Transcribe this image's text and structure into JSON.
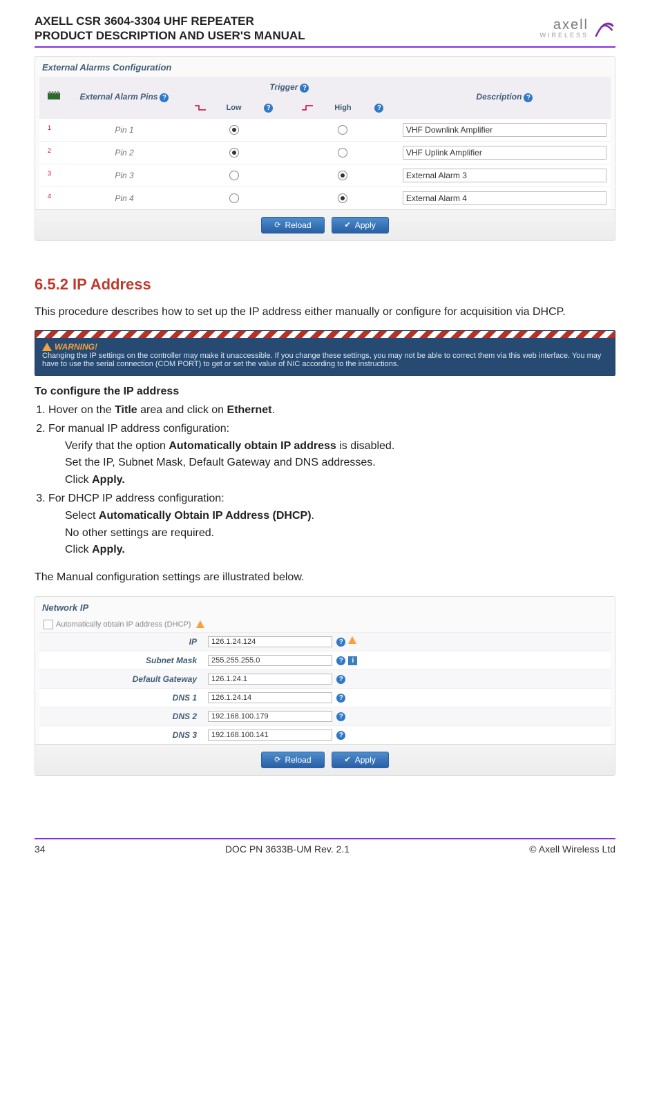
{
  "header": {
    "line1": "AXELL CSR 3604-3304 UHF REPEATER",
    "line2": "PRODUCT DESCRIPTION AND USER'S MANUAL",
    "logo_word": "axell",
    "logo_sub": "WIRELESS"
  },
  "alarms_panel": {
    "title": "External Alarms Configuration",
    "col_pins": "External Alarm Pins",
    "col_trigger": "Trigger",
    "col_low": "Low",
    "col_high": "High",
    "col_desc": "Description",
    "rows": [
      {
        "pin": "Pin 1",
        "sup": "1",
        "low": true,
        "high": false,
        "desc": "VHF Downlink Amplifier"
      },
      {
        "pin": "Pin 2",
        "sup": "2",
        "low": true,
        "high": false,
        "desc": "VHF Uplink Amplifier"
      },
      {
        "pin": "Pin 3",
        "sup": "3",
        "low": false,
        "high": true,
        "desc": "External Alarm 3"
      },
      {
        "pin": "Pin 4",
        "sup": "4",
        "low": false,
        "high": true,
        "desc": "External Alarm 4"
      }
    ],
    "reload": "Reload",
    "apply": "Apply"
  },
  "section": {
    "heading": "6.5.2 IP Address",
    "intro": "This procedure describes how to set up the IP address either manually or configure for acquisition via DHCP.",
    "warning_title": "WARNING!",
    "warning_body": "Changing the IP settings on the controller may make it unaccessible. If you change these settings, you may not be able to correct them via this web interface. You may have to use the serial connection (COM PORT) to get or set the value of NIC according to the instructions.",
    "subhead": "To configure the IP address",
    "step1_a": "Hover on the ",
    "step1_b": "Title",
    "step1_c": " area and click on ",
    "step1_d": "Ethernet",
    "step1_e": ".",
    "step2": "For manual IP address configuration:",
    "step2_a_pre": "Verify that the option ",
    "step2_a_bold": "Automatically obtain IP address",
    "step2_a_post": " is disabled.",
    "step2_b": "Set the IP, Subnet Mask, Default Gateway and DNS addresses.",
    "step2_c_pre": "Click ",
    "step2_c_bold": "Apply.",
    "step3": "For DHCP IP address configuration:",
    "step3_a_pre": "Select ",
    "step3_a_bold": "Automatically Obtain IP Address (DHCP)",
    "step3_a_post": ".",
    "step3_b": "No other settings are required.",
    "step3_c_pre": "Click ",
    "step3_c_bold": "Apply.",
    "closing": "The Manual configuration settings are illustrated below."
  },
  "ip_panel": {
    "title": "Network IP",
    "auto_label": "Automatically obtain IP address (DHCP)",
    "fields": [
      {
        "label": "IP",
        "value": "126.1.24.124",
        "warn": true,
        "info": false
      },
      {
        "label": "Subnet Mask",
        "value": "255.255.255.0",
        "warn": false,
        "info": true
      },
      {
        "label": "Default Gateway",
        "value": "126.1.24.1",
        "warn": false,
        "info": false
      },
      {
        "label": "DNS 1",
        "value": "126.1.24.14",
        "warn": false,
        "info": false
      },
      {
        "label": "DNS 2",
        "value": "192.168.100.179",
        "warn": false,
        "info": false
      },
      {
        "label": "DNS 3",
        "value": "192.168.100.141",
        "warn": false,
        "info": false
      }
    ],
    "reload": "Reload",
    "apply": "Apply"
  },
  "footer": {
    "page": "34",
    "doc": "DOC PN 3633B-UM Rev. 2.1",
    "copy": "© Axell Wireless Ltd"
  }
}
